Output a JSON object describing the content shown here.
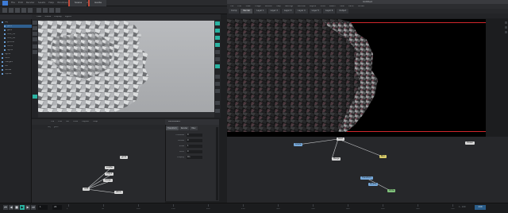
{
  "host": {
    "menus": [
      "File",
      "Edit",
      "Render",
      "Assets",
      "Help",
      "Windows",
      "Desktop",
      "Help"
    ],
    "tabs": [
      "Scene",
      "Guide"
    ],
    "outliner": {
      "header": "",
      "items": [
        "obj",
        "geo1",
        "geo2",
        "rock_01",
        "rock_02",
        "ground",
        "cam1",
        "light1",
        "light2",
        "null1",
        "merge1",
        "out",
        "render",
        "ropnet"
      ],
      "selected_index": 1
    }
  },
  "viewport_left": {
    "menus": [
      "View",
      "Shade",
      "Display",
      "Lights"
    ]
  },
  "node_editor_left": {
    "menus": [
      "File",
      "Edit",
      "Go",
      "Tools",
      "Layout",
      "Help"
    ],
    "sub": [
      "obj",
      "geo1"
    ],
    "nodes": [
      {
        "label": "grid1",
        "kind": "plain"
      },
      {
        "label": "scatter",
        "kind": "plain"
      },
      {
        "label": "copy1",
        "kind": "plain"
      },
      {
        "label": "merge",
        "kind": "plain"
      },
      {
        "label": "out1",
        "kind": "plain"
      },
      {
        "label": "attrib",
        "kind": "plain"
      }
    ]
  },
  "properties": {
    "title": "Parameters",
    "tabs": [
      "Transform",
      "Render",
      "Misc"
    ],
    "rows": [
      {
        "label": "Translate",
        "value": "0"
      },
      {
        "label": "Rotate",
        "value": "0"
      },
      {
        "label": "Scale",
        "value": "1"
      },
      {
        "label": "Pivot",
        "value": "0"
      },
      {
        "label": "Display",
        "value": "On"
      }
    ]
  },
  "guest": {
    "title": "Untitled",
    "menus": [
      "File",
      "Edit",
      "View",
      "Image",
      "Render",
      "Help",
      "Settings",
      "Window",
      "Layers",
      "Tools",
      "Select",
      "Filter",
      "Paint",
      "Nodes"
    ],
    "tabs": [
      "Comp",
      "Render",
      "Layer 1",
      "Layer 2",
      "Layer 3",
      "Layer 4",
      "Layer 5",
      "Layer 6",
      "Output"
    ],
    "active_tab_index": 1
  },
  "node_editor_right": {
    "nodes": [
      {
        "label": "Read",
        "kind": "plain"
      },
      {
        "label": "Grade",
        "kind": "blue"
      },
      {
        "label": "Merge",
        "kind": "plain"
      },
      {
        "label": "Blur",
        "kind": "yellow"
      },
      {
        "label": "Transform",
        "kind": "blue"
      },
      {
        "label": "Shuffle",
        "kind": "blue"
      },
      {
        "label": "Write",
        "kind": "green"
      },
      {
        "label": "Viewer",
        "kind": "plain"
      }
    ]
  },
  "timeline": {
    "current_frame": "1",
    "fps": "24",
    "ticks": [
      "1",
      "50",
      "100",
      "150",
      "200",
      "250",
      "300",
      "350",
      "400",
      "450",
      "500",
      "550"
    ],
    "range_end": "240",
    "status": "1 - 240"
  },
  "colors": {
    "accent": "#2bb3a2",
    "redline": "#d0262b",
    "selection": "#2f5f8f"
  }
}
